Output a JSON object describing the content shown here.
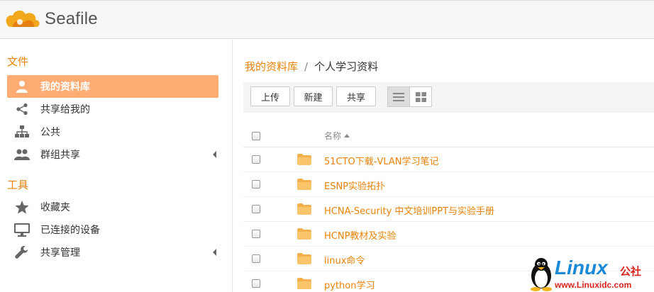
{
  "app": {
    "name": "Seafile"
  },
  "sidebar": {
    "files_title": "文件",
    "files_items": [
      {
        "label": "我的资料库",
        "icon": "user-icon",
        "active": true
      },
      {
        "label": "共享给我的",
        "icon": "share-icon"
      },
      {
        "label": "公共",
        "icon": "org-chart-icon"
      },
      {
        "label": "群组共享",
        "icon": "group-icon",
        "expandable": true
      }
    ],
    "tools_title": "工具",
    "tools_items": [
      {
        "label": "收藏夹",
        "icon": "star-icon"
      },
      {
        "label": "已连接的设备",
        "icon": "monitor-icon"
      },
      {
        "label": "共享管理",
        "icon": "wrench-icon",
        "expandable": true
      }
    ]
  },
  "breadcrumb": {
    "library": "我的资料库",
    "separator": "/",
    "current": "个人学习资料"
  },
  "toolbar": {
    "upload_label": "上传",
    "new_label": "新建",
    "share_label": "共享"
  },
  "table": {
    "name_header": "名称"
  },
  "files": [
    {
      "name": "51CTO下载-VLAN学习笔记"
    },
    {
      "name": "ESNP实验拓扑"
    },
    {
      "name": "HCNA-Security 中文培训PPT与实验手册"
    },
    {
      "name": "HCNP教材及实验"
    },
    {
      "name": "linux命令"
    },
    {
      "name": "python学习"
    }
  ],
  "watermark": {
    "title": "Linux",
    "suffix": "公社",
    "url": "www.Linuxidc.com"
  },
  "colors": {
    "accent": "#eb8205",
    "active_bg": "#feac74",
    "watermark_blue": "#1a89d6",
    "watermark_red": "#d9241c"
  }
}
